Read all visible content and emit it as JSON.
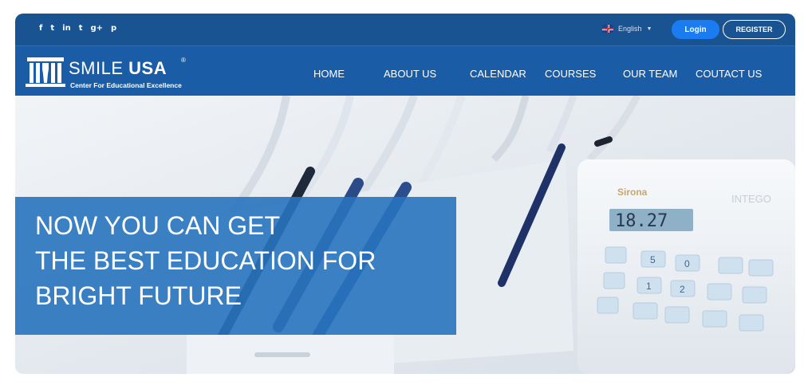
{
  "topbar": {
    "social_icons": [
      {
        "name": "facebook-icon",
        "glyph": "f"
      },
      {
        "name": "twitter-icon",
        "glyph": "t"
      },
      {
        "name": "linkedin-icon",
        "glyph": "in"
      },
      {
        "name": "tumblr-icon",
        "glyph": "t"
      },
      {
        "name": "google-plus-icon",
        "glyph": "g+"
      },
      {
        "name": "pinterest-icon",
        "glyph": "p"
      }
    ],
    "language": "English",
    "login_label": "Login",
    "register_label": "REGISTER"
  },
  "logo": {
    "brand_light": "SMILE ",
    "brand_bold": "USA",
    "registered": "®",
    "tagline": "Center For Educational Excellence"
  },
  "nav": {
    "items": [
      "HOME",
      "ABOUT US",
      "CALENDAR",
      "COURSES",
      "OUR TEAM",
      "COUTACT US"
    ]
  },
  "hero": {
    "headline_lines": [
      "NOW YOU CAN GET",
      "THE BEST EDUCATION FOR",
      "BRIGHT FUTURE"
    ],
    "device_brand": "Sirona",
    "device_model": "INTEGO",
    "display_value": "18.27",
    "keypad_digits": [
      "5",
      "0",
      "1",
      "2"
    ]
  },
  "colors": {
    "topbar": "#1a5392",
    "navbar": "#1a5ca6",
    "login_button": "#1b7cf2",
    "headline_box": "#2873be"
  }
}
